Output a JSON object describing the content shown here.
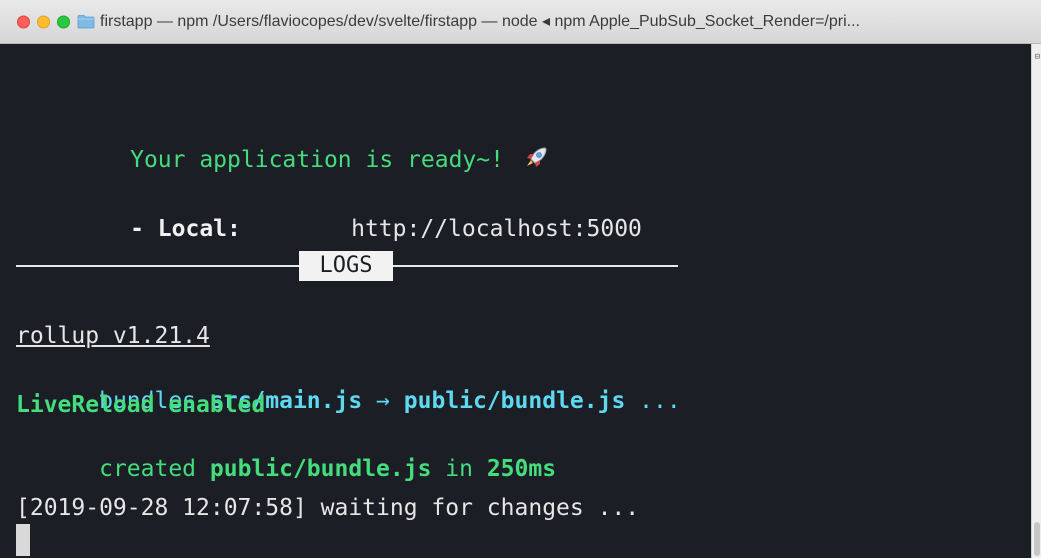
{
  "window": {
    "title": "firstapp — npm   /Users/flaviocopes/dev/svelte/firstapp — node ◂ npm Apple_PubSub_Socket_Render=/pri...",
    "icon": "folder-icon",
    "scrollbar_glyph": "⊟"
  },
  "terminal": {
    "ready_message": "Your application is ready~! ",
    "ready_icon": "rocket-icon",
    "local_label": "- Local:",
    "local_url": "http://localhost:5000",
    "logs_label": "LOGS",
    "rollup_version": "rollup v1.21.4",
    "bundles_prefix": "bundles ",
    "bundles_source": "src/main.js",
    "bundles_arrow": " → ",
    "bundles_target": "public/bundle.js",
    "bundles_suffix": " ...",
    "livereload": "LiveReload enabled",
    "created_prefix": "created ",
    "created_file": "public/bundle.js",
    "created_mid": " in ",
    "created_time": "250ms",
    "waiting_line": "[2019-09-28 12:07:58] waiting for changes ..."
  },
  "colors": {
    "background": "#1c1e26",
    "green": "#44dc7c",
    "cyan": "#5ed9f2",
    "text": "#e6e6e6"
  }
}
